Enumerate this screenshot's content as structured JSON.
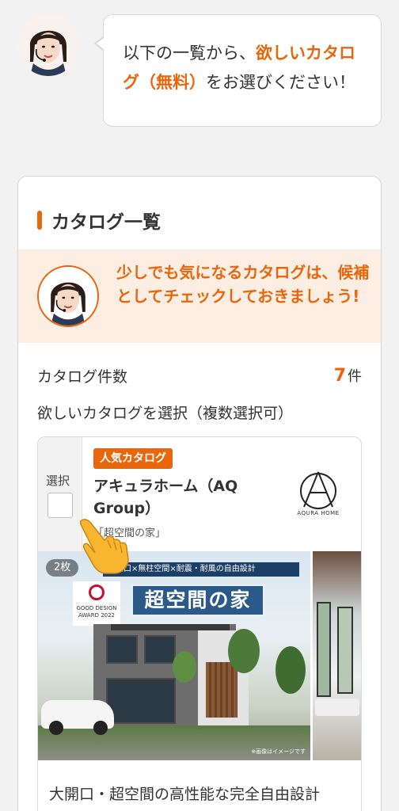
{
  "intro": {
    "avatar_icon": "operator-avatar-icon",
    "message_part1": "以下の一覧から、",
    "message_highlight": "欲しいカタログ（無料）",
    "message_part2": "をお選びください！"
  },
  "catalog_list": {
    "title": "カタログ一覧",
    "tip": {
      "avatar_icon": "operator-avatar-icon",
      "text": "少しでも気になるカタログは、候補としてチェックしておきましょう!"
    },
    "count_label": "カタログ件数",
    "count_value": "7",
    "count_unit": "件",
    "select_instruction": "欲しいカタログを選択（複数選択可）",
    "items": [
      {
        "select_label": "選択",
        "checked": false,
        "badge": "人気カタログ",
        "name": "アキュラホーム（AQ Group）",
        "sub_title": "「超空間の家」",
        "brand_logo_text": "AQURA HOME",
        "photo": {
          "count": "2枚",
          "banner": "大開口×無柱空間×耐震・耐風の自由設計",
          "award": "GOOD DESIGN AWARD 2022",
          "title": "超空間の家",
          "note": "※画像はイメージです"
        },
        "description": "大開口・超空間の高性能な完全自由設計"
      }
    ]
  },
  "colors": {
    "accent": "#e8660c",
    "tip_background": "#fdeee3",
    "page_background": "#f2f2f2"
  }
}
